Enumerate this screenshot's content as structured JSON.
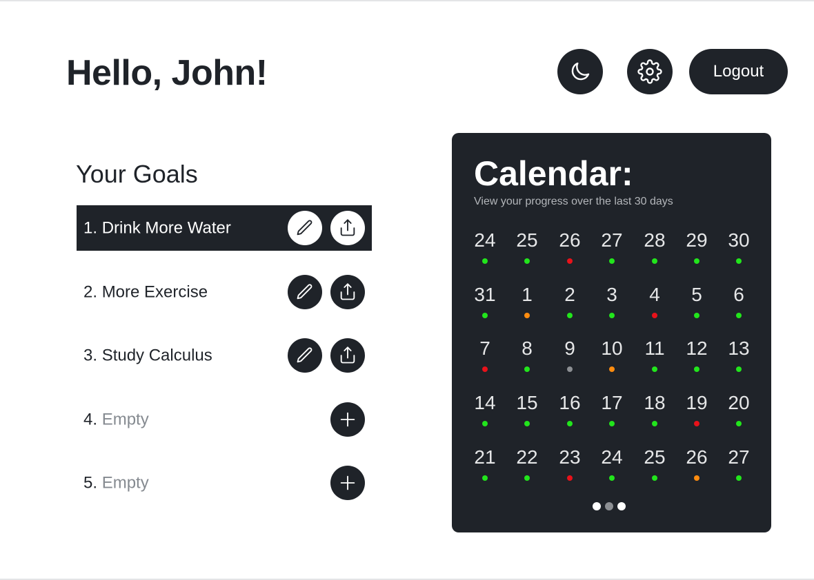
{
  "header": {
    "greeting": "Hello, John!",
    "dark_mode_icon": "moon-icon",
    "settings_icon": "gear-icon",
    "logout_label": "Logout"
  },
  "goals": {
    "title": "Your Goals",
    "items": [
      {
        "number": "1.",
        "label": "Drink More Water",
        "empty": false,
        "selected": true
      },
      {
        "number": "2.",
        "label": "More Exercise",
        "empty": false,
        "selected": false
      },
      {
        "number": "3.",
        "label": "Study Calculus",
        "empty": false,
        "selected": false
      },
      {
        "number": "4.",
        "label": "Empty",
        "empty": true,
        "selected": false
      },
      {
        "number": "5.",
        "label": "Empty",
        "empty": true,
        "selected": false
      }
    ],
    "edit_icon": "pencil-icon",
    "share_icon": "share-icon",
    "add_icon": "plus-icon"
  },
  "calendar": {
    "title": "Calendar:",
    "subtitle": "View your progress over the last 30 days",
    "status_colors": {
      "green": "#22e51c",
      "red": "#e8121a",
      "orange": "#ff8c0f",
      "gray": "#8c8f93"
    },
    "weeks": [
      [
        {
          "day": "24",
          "status": "green"
        },
        {
          "day": "25",
          "status": "green"
        },
        {
          "day": "26",
          "status": "red"
        },
        {
          "day": "27",
          "status": "green"
        },
        {
          "day": "28",
          "status": "green"
        },
        {
          "day": "29",
          "status": "green"
        },
        {
          "day": "30",
          "status": "green"
        }
      ],
      [
        {
          "day": "31",
          "status": "green"
        },
        {
          "day": "1",
          "status": "orange"
        },
        {
          "day": "2",
          "status": "green"
        },
        {
          "day": "3",
          "status": "green"
        },
        {
          "day": "4",
          "status": "red"
        },
        {
          "day": "5",
          "status": "green"
        },
        {
          "day": "6",
          "status": "green"
        }
      ],
      [
        {
          "day": "7",
          "status": "red"
        },
        {
          "day": "8",
          "status": "green"
        },
        {
          "day": "9",
          "status": "gray"
        },
        {
          "day": "10",
          "status": "orange"
        },
        {
          "day": "11",
          "status": "green"
        },
        {
          "day": "12",
          "status": "green"
        },
        {
          "day": "13",
          "status": "green"
        }
      ],
      [
        {
          "day": "14",
          "status": "green"
        },
        {
          "day": "15",
          "status": "green"
        },
        {
          "day": "16",
          "status": "green"
        },
        {
          "day": "17",
          "status": "green"
        },
        {
          "day": "18",
          "status": "green"
        },
        {
          "day": "19",
          "status": "red"
        },
        {
          "day": "20",
          "status": "green"
        }
      ],
      [
        {
          "day": "21",
          "status": "green"
        },
        {
          "day": "22",
          "status": "green"
        },
        {
          "day": "23",
          "status": "red"
        },
        {
          "day": "24",
          "status": "green"
        },
        {
          "day": "25",
          "status": "green"
        },
        {
          "day": "26",
          "status": "orange"
        },
        {
          "day": "27",
          "status": "green"
        }
      ]
    ],
    "pager": {
      "pages": 3,
      "active_index": 1,
      "active_color": "#8c8f93",
      "inactive_color": "#ffffff"
    }
  }
}
